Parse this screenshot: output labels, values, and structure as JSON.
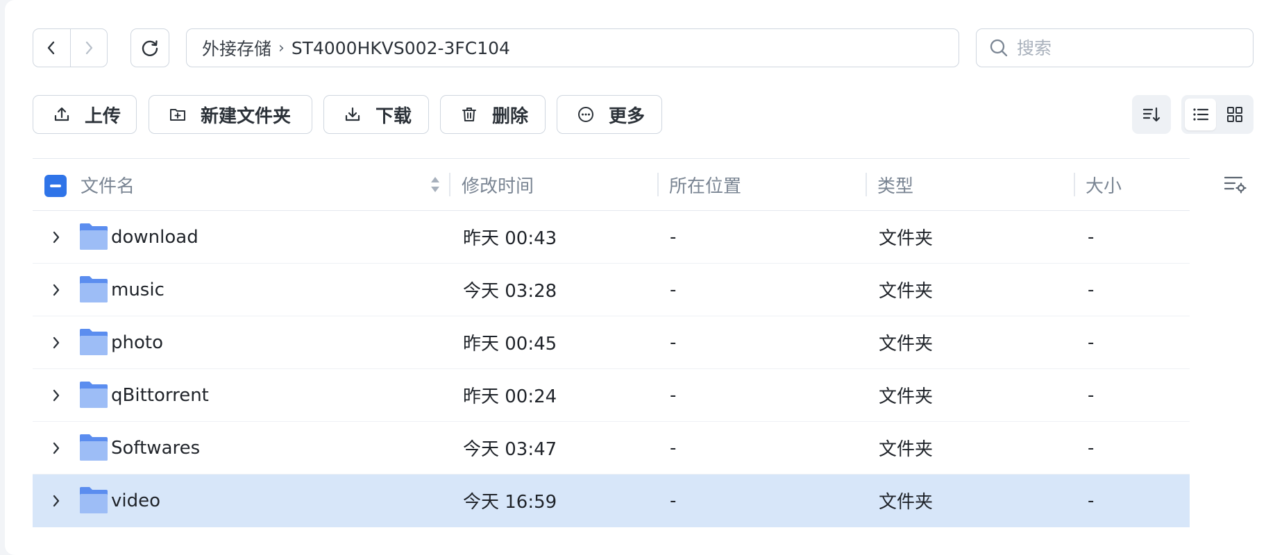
{
  "breadcrumb": {
    "root": "外接存储",
    "current": "ST4000HKVS002-3FC104"
  },
  "search": {
    "placeholder": "搜索",
    "value": ""
  },
  "toolbar": {
    "upload": "上传",
    "new_folder": "新建文件夹",
    "download": "下载",
    "delete": "删除",
    "more": "更多"
  },
  "table": {
    "columns": {
      "name": "文件名",
      "modified": "修改时间",
      "location": "所在位置",
      "type": "类型",
      "size": "大小"
    },
    "rows": [
      {
        "name": "download",
        "modified": "昨天 00:43",
        "location": "-",
        "type": "文件夹",
        "size": "-"
      },
      {
        "name": "music",
        "modified": "今天 03:28",
        "location": "-",
        "type": "文件夹",
        "size": "-"
      },
      {
        "name": "photo",
        "modified": "昨天 00:45",
        "location": "-",
        "type": "文件夹",
        "size": "-"
      },
      {
        "name": "qBittorrent",
        "modified": "昨天 00:24",
        "location": "-",
        "type": "文件夹",
        "size": "-"
      },
      {
        "name": "Softwares",
        "modified": "今天 03:47",
        "location": "-",
        "type": "文件夹",
        "size": "-"
      },
      {
        "name": "video",
        "modified": "今天 16:59",
        "location": "-",
        "type": "文件夹",
        "size": "-"
      }
    ]
  },
  "colors": {
    "accent": "#2f74e8",
    "selected_row": "#d7e6f9",
    "folder_back": "#5b8def",
    "folder_front": "#9dbdf6"
  }
}
